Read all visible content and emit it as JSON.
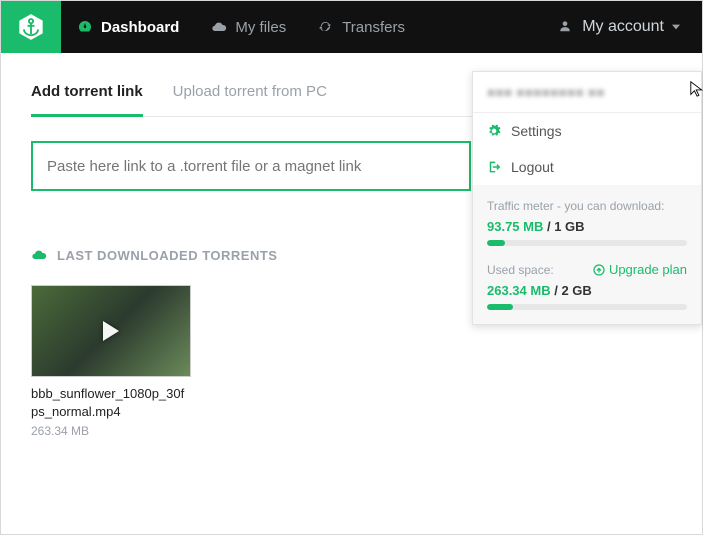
{
  "colors": {
    "accent": "#1abc6b"
  },
  "nav": {
    "dashboard": "Dashboard",
    "myfiles": "My files",
    "transfers": "Transfers",
    "account": "My account"
  },
  "tabs": {
    "add_link": "Add torrent link",
    "upload_pc": "Upload torrent from PC"
  },
  "input": {
    "placeholder": "Paste here link to a .torrent file or a magnet link"
  },
  "section": {
    "last": "LAST DOWNLOADED TORRENTS"
  },
  "file": {
    "name": "bbb_sunflower_1080p_30fps_normal.mp4",
    "size": "263.34 MB"
  },
  "dropdown": {
    "settings": "Settings",
    "logout": "Logout",
    "traffic_label": "Traffic meter - you can download:",
    "traffic_used": "93.75 MB",
    "traffic_total": "1 GB",
    "traffic_pct": 9,
    "space_label": "Used space:",
    "space_used": "263.34 MB",
    "space_total": "2 GB",
    "space_pct": 13,
    "upgrade": "Upgrade plan"
  }
}
